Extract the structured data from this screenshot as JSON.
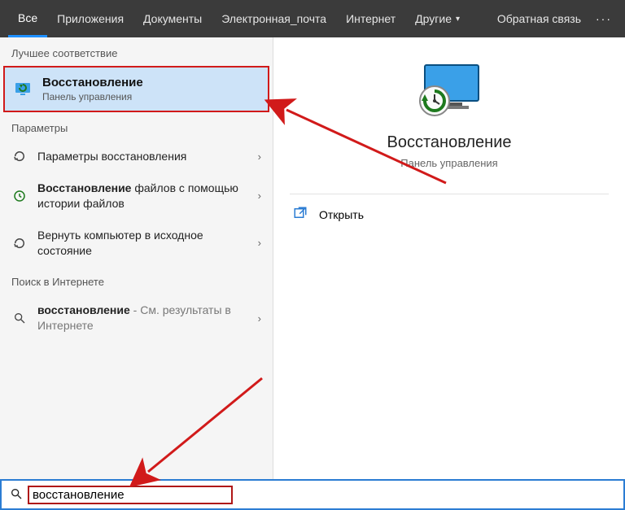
{
  "topbar": {
    "tabs": [
      {
        "label": "Все",
        "active": true
      },
      {
        "label": "Приложения"
      },
      {
        "label": "Документы"
      },
      {
        "label": "Электронная_почта"
      },
      {
        "label": "Интернет"
      },
      {
        "label": "Другие",
        "caret": true
      }
    ],
    "feedback": "Обратная связь",
    "more": "···"
  },
  "left": {
    "best_label": "Лучшее соответствие",
    "best_match": {
      "title": "Восстановление",
      "sub": "Панель управления"
    },
    "params_label": "Параметры",
    "params": [
      {
        "text": "Параметры восстановления"
      },
      {
        "bold": "Восстановление",
        "rest": " файлов с помощью истории файлов"
      },
      {
        "text": "Вернуть компьютер в исходное состояние"
      }
    ],
    "web_label": "Поиск в Интернете",
    "web": {
      "bold": "восстановление",
      "rest": " - См. результаты в Интернете"
    }
  },
  "right": {
    "title": "Восстановление",
    "sub": "Панель управления",
    "open": "Открыть"
  },
  "search": {
    "query": "восстановление"
  }
}
